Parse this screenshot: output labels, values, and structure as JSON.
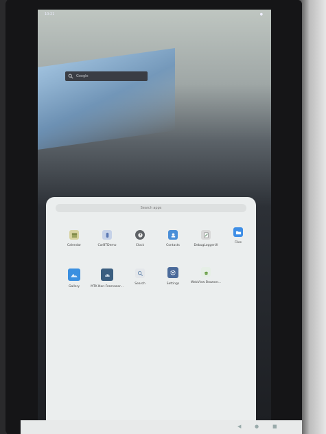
{
  "status_bar": {
    "time": "10:21",
    "battery": "●"
  },
  "home_search": {
    "placeholder": "Google"
  },
  "drawer": {
    "search_placeholder": "Search apps",
    "apps": [
      {
        "label": "Calendar",
        "icon": "calendar-icon",
        "color": "#d7d3a2"
      },
      {
        "label": "CarBTDemo",
        "icon": "bluetooth-icon",
        "color": "#c6d2e8"
      },
      {
        "label": "Clock",
        "icon": "clock-icon",
        "color": "#5e6266"
      },
      {
        "label": "Contacts",
        "icon": "contacts-icon",
        "color": "#4a8fd8"
      },
      {
        "label": "DebugLoggerUI",
        "icon": "notepad-icon",
        "color": "#d8d8d8"
      },
      {
        "label": "Files",
        "icon": "folder-icon",
        "color": "#3e8ee6"
      },
      {
        "label": "Gallery",
        "icon": "gallery-icon",
        "color": "#3a8fe0"
      },
      {
        "label": "MTK Non-Framewor...",
        "icon": "android-icon",
        "color": "#3b5e80"
      },
      {
        "label": "Search",
        "icon": "search-icon",
        "color": "#e4e7ea"
      },
      {
        "label": "Settings",
        "icon": "gear-icon",
        "color": "#4a6a9a"
      },
      {
        "label": "WebView Browser...",
        "icon": "android-icon",
        "color": "#e6efe6"
      }
    ]
  },
  "navbar": {
    "back": "◀",
    "home": "●",
    "recents": "■"
  }
}
